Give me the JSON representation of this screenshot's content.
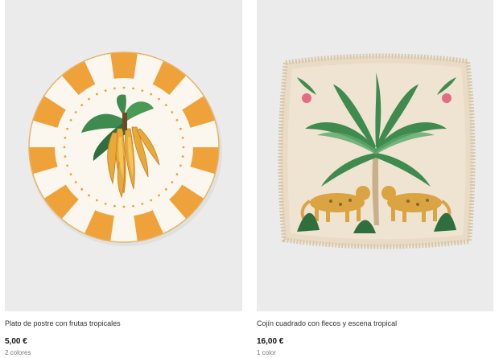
{
  "products": [
    {
      "name": "Plato de postre con frutas tropicales",
      "price": "5,00 €",
      "colors": "2 colores"
    },
    {
      "name": "Cojín cuadrado con flecos y escena tropical",
      "price": "16,00 €",
      "colors": "1 color"
    }
  ],
  "palette": {
    "image_bg": "#ebebeb",
    "plate_stripe": "#f0a23a",
    "plate_base": "#fbf7ee",
    "cushion_base": "#efe3d1",
    "leaf_green": "#3f8a4f",
    "leopard": "#d9a441"
  }
}
